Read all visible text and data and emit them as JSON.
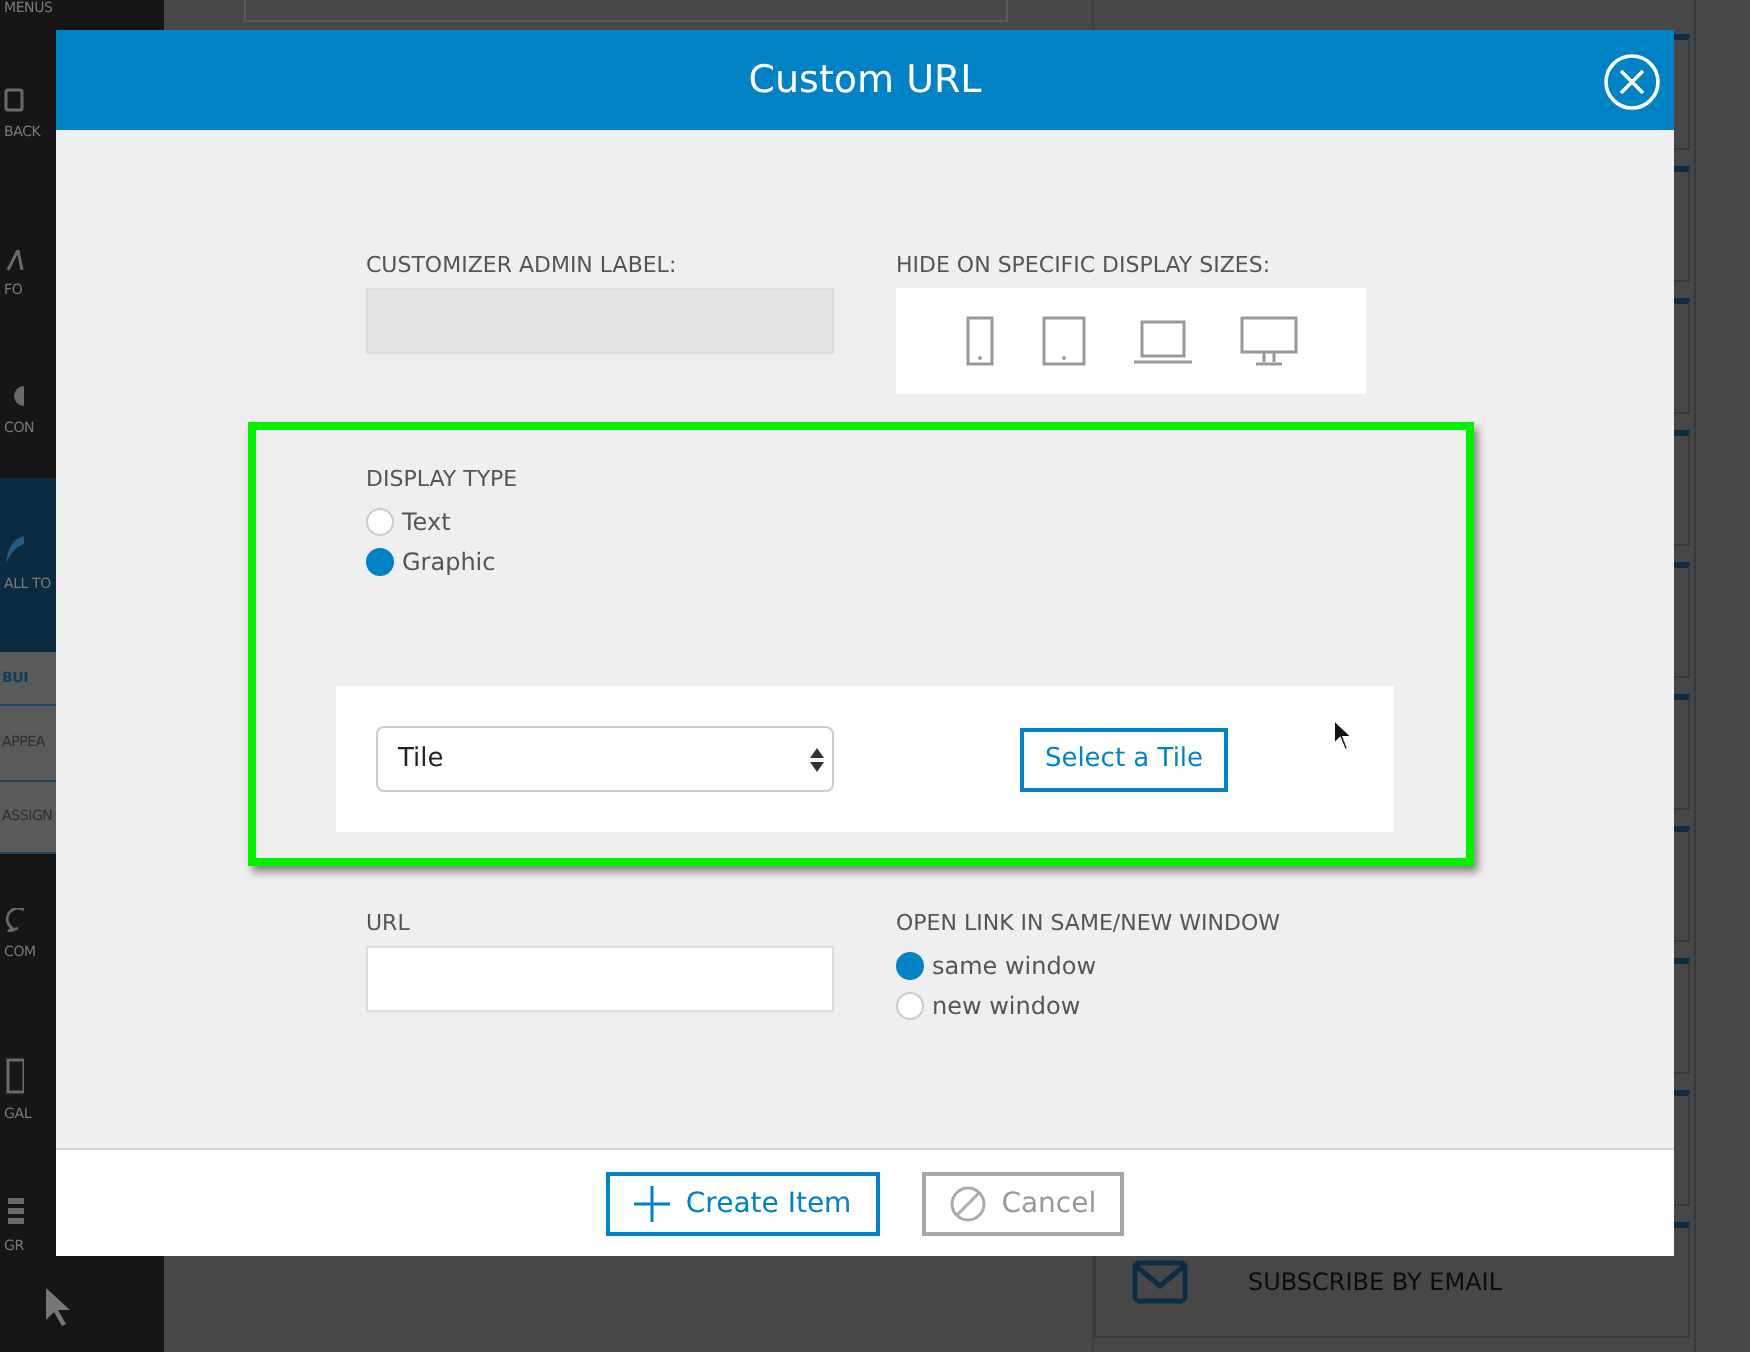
{
  "sidebar": {
    "items": [
      {
        "label": "MENUS",
        "kind": "tool",
        "selected": false
      },
      {
        "label": "BACK",
        "kind": "tool",
        "selected": false
      },
      {
        "label": "FO",
        "kind": "tool",
        "selected": false
      },
      {
        "label": "CON",
        "kind": "tool",
        "selected": false
      },
      {
        "label": "ALL TO",
        "kind": "tool",
        "selected": true
      },
      {
        "label": "BUI",
        "kind": "subtab",
        "selected": true
      },
      {
        "label": "APPEA",
        "kind": "subtab",
        "selected": false
      },
      {
        "label": "ASSIGN",
        "kind": "subtab",
        "selected": false
      },
      {
        "label": "COM",
        "kind": "tool",
        "selected": false
      },
      {
        "label": "GAL",
        "kind": "tool",
        "selected": false
      },
      {
        "label": "GR",
        "kind": "tool",
        "selected": false
      }
    ]
  },
  "side_panel": {
    "items": [
      {
        "label": "SUBSCRIBE BY EMAIL"
      }
    ]
  },
  "dialog": {
    "title": "Custom URL",
    "admin_label": {
      "label": "CUSTOMIZER ADMIN LABEL:"
    },
    "hide_sizes": {
      "label": "HIDE ON SPECIFIC DISPLAY SIZES:"
    },
    "display_type": {
      "label": "DISPLAY TYPE",
      "options": [
        {
          "label": "Text",
          "selected": false
        },
        {
          "label": "Graphic",
          "selected": true
        }
      ]
    },
    "graphic": {
      "select_value": "Tile",
      "button": "Select a Tile"
    },
    "url": {
      "label": "URL"
    },
    "open_link": {
      "label": "OPEN LINK IN SAME/NEW WINDOW",
      "options": [
        {
          "label": "same window",
          "selected": true
        },
        {
          "label": "new window",
          "selected": false
        }
      ]
    },
    "buttons": [
      {
        "label": "Create Item",
        "kind": "primary"
      },
      {
        "label": "Cancel",
        "kind": "secondary"
      }
    ]
  }
}
